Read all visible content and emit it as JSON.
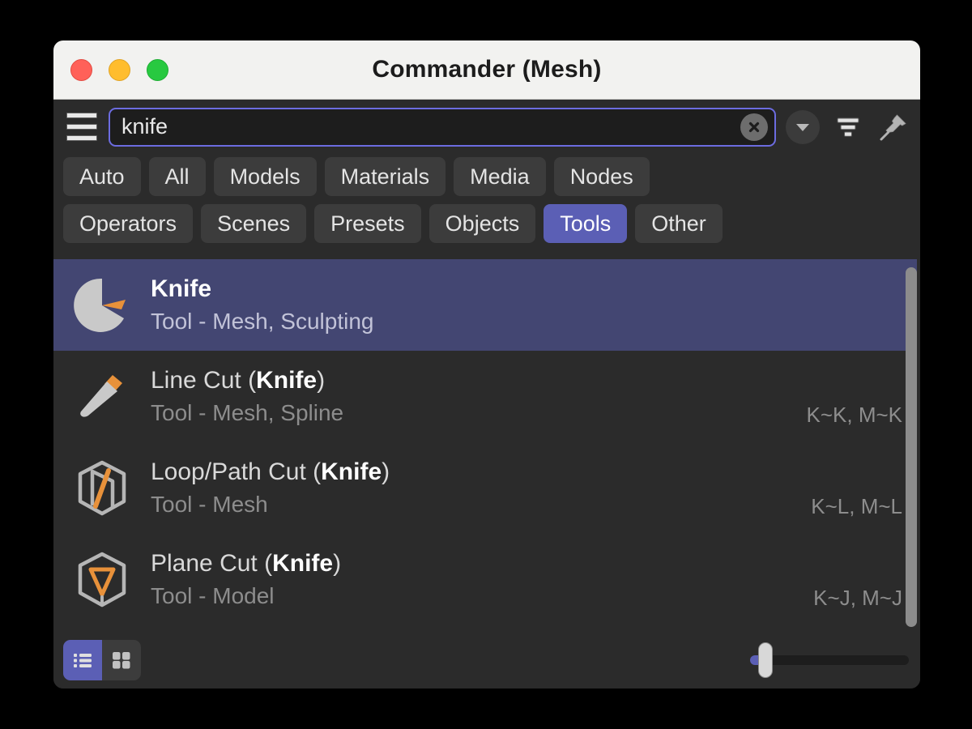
{
  "window": {
    "title": "Commander (Mesh)",
    "controls": [
      {
        "name": "close",
        "color": "#ff6159"
      },
      {
        "name": "minimize",
        "color": "#ffbd2e"
      },
      {
        "name": "zoom",
        "color": "#28c940"
      }
    ]
  },
  "toolbar": {
    "menu_icon": "hamburger-menu-icon",
    "dropdown_icon": "chevron-down-icon",
    "filter_icon": "filter-icon",
    "pin_icon": "pin-icon"
  },
  "search": {
    "value": "knife",
    "placeholder": "Search",
    "clear_icon": "clear-circle-icon"
  },
  "tabs": {
    "row1": [
      {
        "label": "Auto",
        "active": false
      },
      {
        "label": "All",
        "active": false
      },
      {
        "label": "Models",
        "active": false
      },
      {
        "label": "Materials",
        "active": false
      },
      {
        "label": "Media",
        "active": false
      },
      {
        "label": "Nodes",
        "active": false
      }
    ],
    "row2": [
      {
        "label": "Operators",
        "active": false
      },
      {
        "label": "Scenes",
        "active": false
      },
      {
        "label": "Presets",
        "active": false
      },
      {
        "label": "Objects",
        "active": false
      },
      {
        "label": "Tools",
        "active": true
      },
      {
        "label": "Other",
        "active": false
      }
    ]
  },
  "results": [
    {
      "title": "Knife",
      "title_plain": "",
      "title_bold": "Knife",
      "title_suffix": "",
      "subtitle": "Tool - Mesh, Sculpting",
      "shortcut": "",
      "icon": "pie-wedge-cut-icon",
      "selected": true
    },
    {
      "title": "Line Cut (Knife)",
      "title_plain": "Line Cut (",
      "title_bold": "Knife",
      "title_suffix": ")",
      "subtitle": "Tool - Mesh, Spline",
      "shortcut": "K~K, M~K",
      "icon": "knife-icon",
      "selected": false
    },
    {
      "title": "Loop/Path Cut (Knife)",
      "title_plain": "Loop/Path Cut (",
      "title_bold": "Knife",
      "title_suffix": ")",
      "subtitle": "Tool - Mesh",
      "shortcut": "K~L, M~L",
      "icon": "cube-slice-icon",
      "selected": false
    },
    {
      "title": "Plane Cut (Knife)",
      "title_plain": "Plane Cut (",
      "title_bold": "Knife",
      "title_suffix": ")",
      "subtitle": "Tool - Model",
      "shortcut": "K~J, M~J",
      "icon": "hexagon-plane-cut-icon",
      "selected": false
    }
  ],
  "bottom": {
    "list_view_icon": "list-view-icon",
    "grid_view_icon": "grid-view-icon",
    "list_view_active": true,
    "grid_view_active": false,
    "zoom_slider_value": "0"
  },
  "colors": {
    "accent": "#5b5fb5",
    "selection": "#434672",
    "background": "#2b2b2b",
    "tab": "#3c3c3c",
    "titlebar": "#f2f2f0",
    "orange": "#e8913a",
    "icon_grey": "#c9c9c9"
  },
  "scroll": {
    "thumb": "list-scrollbar-thumb"
  }
}
